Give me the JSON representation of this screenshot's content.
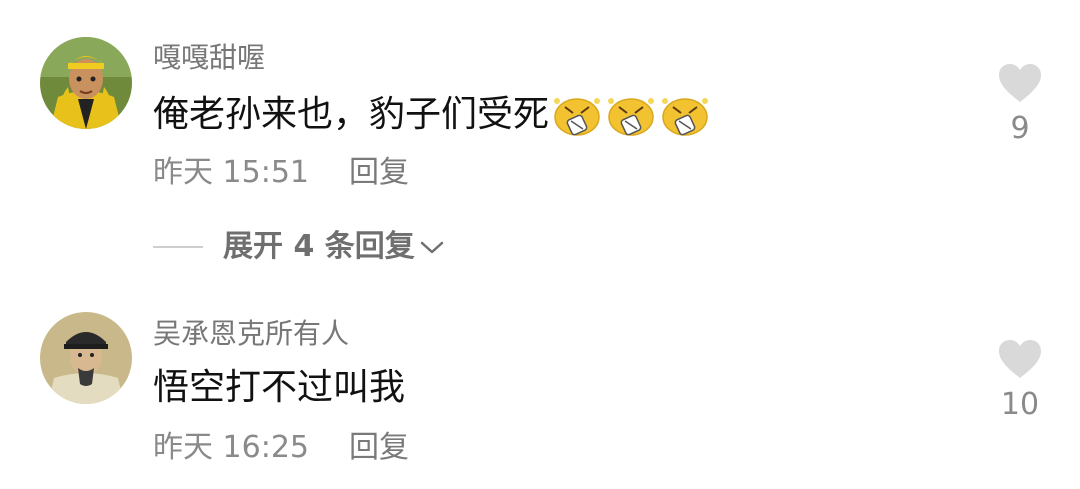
{
  "comments": [
    {
      "username": "嘎嘎甜喔",
      "text": "俺老孙来也，豹子们受死",
      "emoji_count": 3,
      "emoji_icon": "shocked-face-icon",
      "time": "昨天 15:51",
      "reply_label": "回复",
      "likes": "9",
      "expand_label": "展开 4 条回复"
    },
    {
      "username": "吴承恩克所有人",
      "text": "悟空打不过叫我",
      "time": "昨天 16:25",
      "reply_label": "回复",
      "likes": "10"
    }
  ],
  "colors": {
    "username": "#777777",
    "text": "#111111",
    "meta": "#8a8a8a",
    "heart": "#d9d9d9",
    "emoji": "#f2c230"
  }
}
